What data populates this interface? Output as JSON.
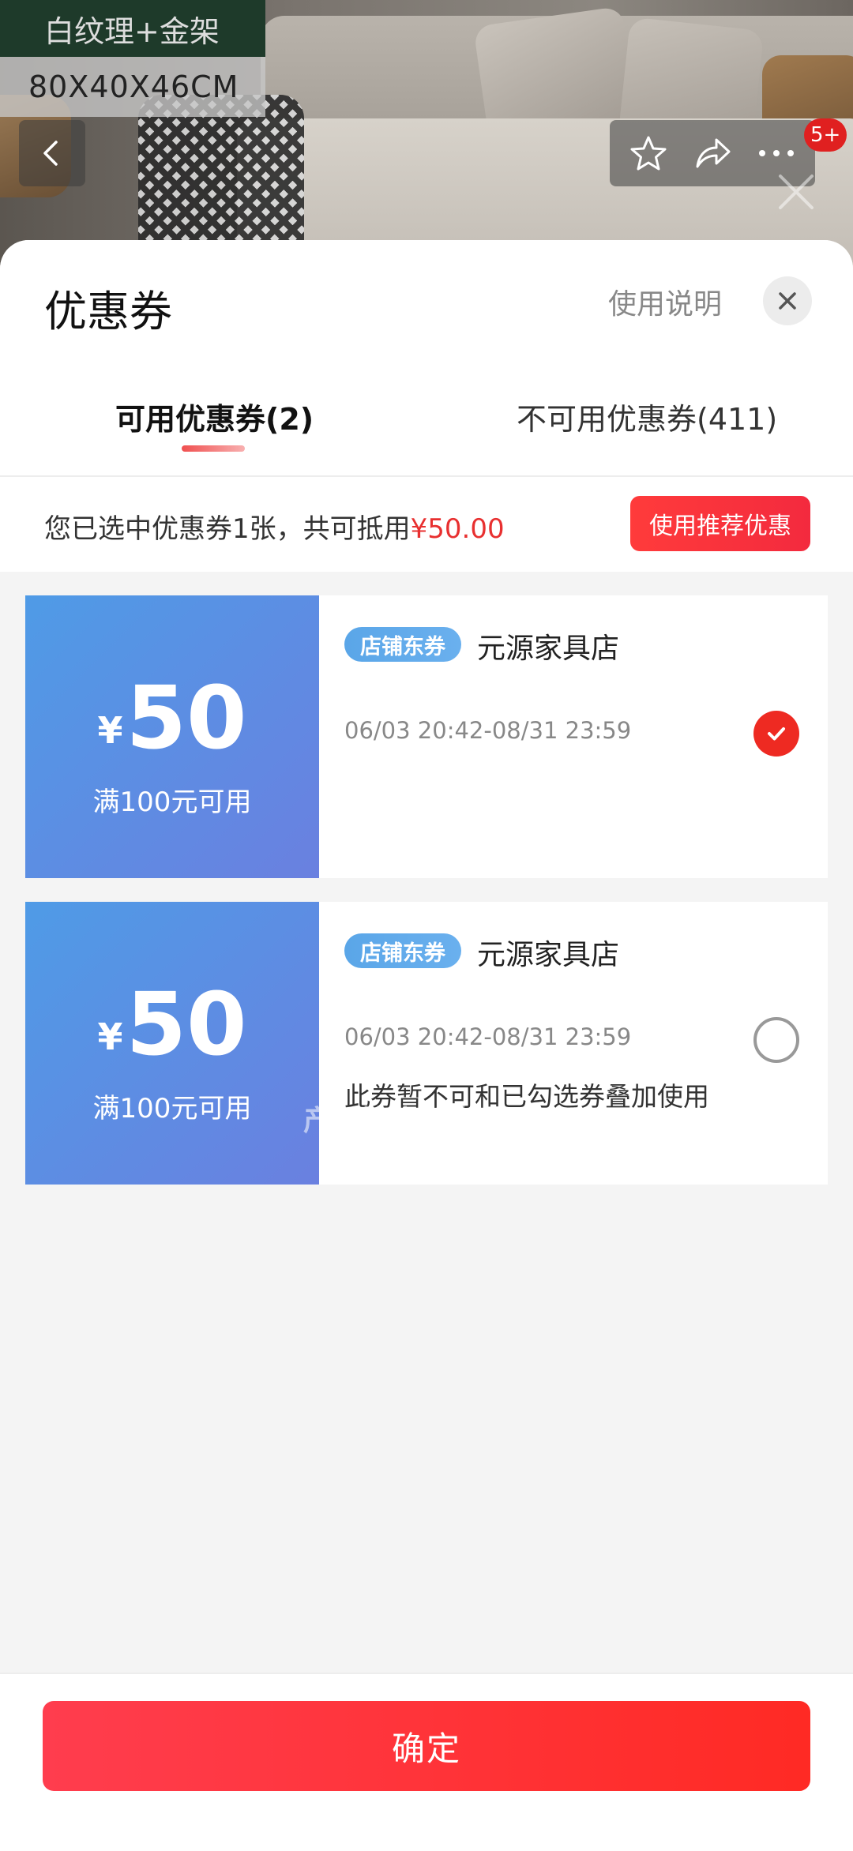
{
  "background": {
    "variant_label": "白纹理+金架",
    "variant_size": "80X40X46CM",
    "cart_badge": "5+"
  },
  "sheet": {
    "title": "优惠券",
    "help_link": "使用说明",
    "tabs": [
      {
        "label": "可用优惠券(2)",
        "active": true
      },
      {
        "label": "不可用优惠券(411)",
        "active": false
      }
    ],
    "summary": {
      "text": "您已选中优惠券1张，共可抵用",
      "amount": "¥50.00"
    },
    "recommend_label": "使用推荐优惠"
  },
  "coupons": [
    {
      "currency": "¥",
      "value": "50",
      "condition": "满100元可用",
      "tag": "店铺东券",
      "shop": "元源家具店",
      "validity": "06/03 20:42-08/31 23:59",
      "note": "",
      "selected": true
    },
    {
      "currency": "¥",
      "value": "50",
      "condition": "满100元可用",
      "tag": "店铺东券",
      "shop": "元源家具店",
      "validity": "06/03 20:42-08/31 23:59",
      "note": "此券暂不可和已勾选券叠加使用",
      "selected": false
    }
  ],
  "watermark": "产品性能优势",
  "footer": {
    "confirm_label": "确定"
  },
  "colors": {
    "accent_red": "#ff2a24",
    "coupon_blue": "#4f9be6",
    "amount_red": "#e83030"
  },
  "icons": {
    "back": "chevron-left-icon",
    "favorite": "star-icon",
    "share": "share-icon",
    "more": "more-icon",
    "close": "close-icon",
    "check": "check-icon"
  }
}
